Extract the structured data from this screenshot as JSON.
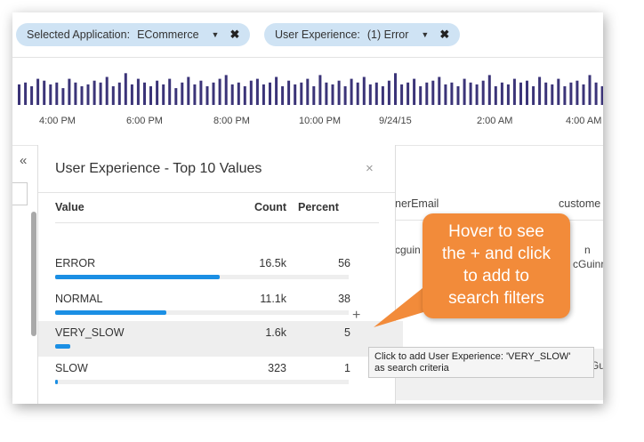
{
  "filters": [
    {
      "label": "Selected Application:",
      "value": "ECommerce"
    },
    {
      "label": "User Experience:",
      "value": "(1) Error"
    }
  ],
  "timeline": {
    "bar_color": "#3b3478",
    "bar_heights": [
      0.55,
      0.6,
      0.5,
      0.7,
      0.65,
      0.55,
      0.6,
      0.45,
      0.7,
      0.6,
      0.5,
      0.55,
      0.65,
      0.6,
      0.75,
      0.5,
      0.6,
      0.85,
      0.55,
      0.7,
      0.6,
      0.5,
      0.65,
      0.55,
      0.7,
      0.45,
      0.6,
      0.75,
      0.55,
      0.65,
      0.5,
      0.6,
      0.7,
      0.8,
      0.55,
      0.6,
      0.5,
      0.65,
      0.7,
      0.55,
      0.6,
      0.75,
      0.5,
      0.65,
      0.55,
      0.6,
      0.7,
      0.5,
      0.8,
      0.6,
      0.55,
      0.65,
      0.5,
      0.7,
      0.6,
      0.75,
      0.55,
      0.6,
      0.5,
      0.65,
      0.85,
      0.55,
      0.6,
      0.7,
      0.5,
      0.6,
      0.65,
      0.75,
      0.55,
      0.6,
      0.5,
      0.7,
      0.6,
      0.55,
      0.65,
      0.8,
      0.5,
      0.6,
      0.55,
      0.7,
      0.6,
      0.65,
      0.5,
      0.75,
      0.6,
      0.55,
      0.7,
      0.5,
      0.6,
      0.65,
      0.55,
      0.8,
      0.6,
      0.5,
      0.7,
      0.6
    ],
    "axis_labels": [
      "4:00 PM",
      "6:00 PM",
      "8:00 PM",
      "10:00 PM",
      "9/24/15",
      "2:00 AM",
      "4:00 AM"
    ]
  },
  "collapse_icon": "«",
  "panel": {
    "title": "User Experience - Top 10 Values",
    "close": "×",
    "columns": {
      "value": "Value",
      "count": "Count",
      "percent": "Percent"
    },
    "rows": [
      {
        "name": "ERROR",
        "count": "16.5k",
        "percent": "56",
        "fill": 0.56
      },
      {
        "name": "NORMAL",
        "count": "11.1k",
        "percent": "38",
        "fill": 0.38
      },
      {
        "name": "VERY_SLOW",
        "count": "1.6k",
        "percent": "5",
        "fill": 0.05
      },
      {
        "name": "SLOW",
        "count": "323",
        "percent": "1",
        "fill": 0.01
      }
    ],
    "bar_color": "#1b8fe4",
    "plus": "+"
  },
  "background_table": {
    "col1": "nerEmail",
    "col2": "custome",
    "fragments": [
      "cguin",
      "n",
      "cGuinr",
      "Gu"
    ]
  },
  "callout": {
    "lines": [
      "Hover to see",
      "the + and click",
      "to add to",
      "search filters"
    ],
    "color": "#f28b3a"
  },
  "tooltip": {
    "line1": "Click to add User Experience: 'VERY_SLOW'",
    "line2": "as search criteria"
  }
}
